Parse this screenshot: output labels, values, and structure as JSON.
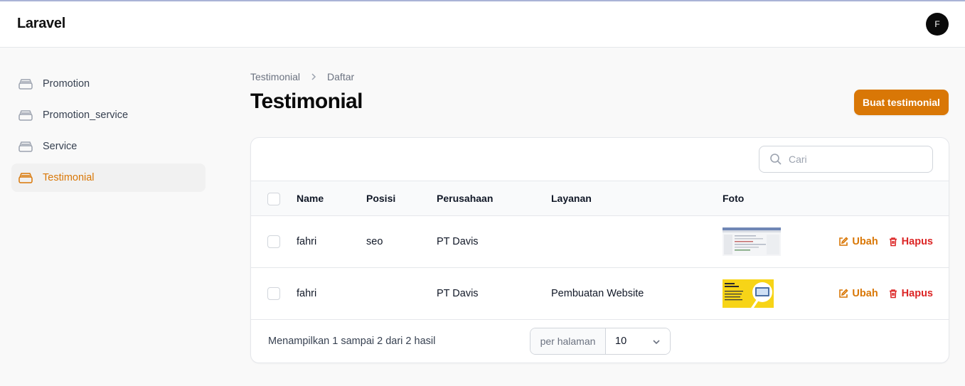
{
  "app": {
    "brand": "Laravel",
    "user_initial": "F"
  },
  "sidebar": {
    "items": [
      {
        "label": "Promotion",
        "active": false
      },
      {
        "label": "Promotion_service",
        "active": false
      },
      {
        "label": "Service",
        "active": false
      },
      {
        "label": "Testimonial",
        "active": true
      }
    ]
  },
  "breadcrumb": {
    "parent": "Testimonial",
    "current": "Daftar"
  },
  "page": {
    "title": "Testimonial",
    "create_label": "Buat testimonial"
  },
  "search": {
    "placeholder": "Cari",
    "value": ""
  },
  "table": {
    "columns": [
      "Name",
      "Posisi",
      "Perusahaan",
      "Layanan",
      "Foto"
    ],
    "rows": [
      {
        "name": "fahri",
        "posisi": "seo",
        "perusahaan": "PT Davis",
        "layanan": "",
        "foto": "screenshot-thumbnail",
        "edit": "Ubah",
        "delete": "Hapus"
      },
      {
        "name": "fahri",
        "posisi": "",
        "perusahaan": "PT Davis",
        "layanan": "Pembuatan Website",
        "foto": "yellow-banner-thumbnail",
        "edit": "Ubah",
        "delete": "Hapus"
      }
    ]
  },
  "pagination": {
    "summary": "Menampilkan 1 sampai 2 dari 2 hasil",
    "per_page_label": "per halaman",
    "per_page_value": "10"
  },
  "colors": {
    "accent": "#d97706",
    "danger": "#dc2626",
    "text": "#111827",
    "muted": "#6b7280"
  }
}
